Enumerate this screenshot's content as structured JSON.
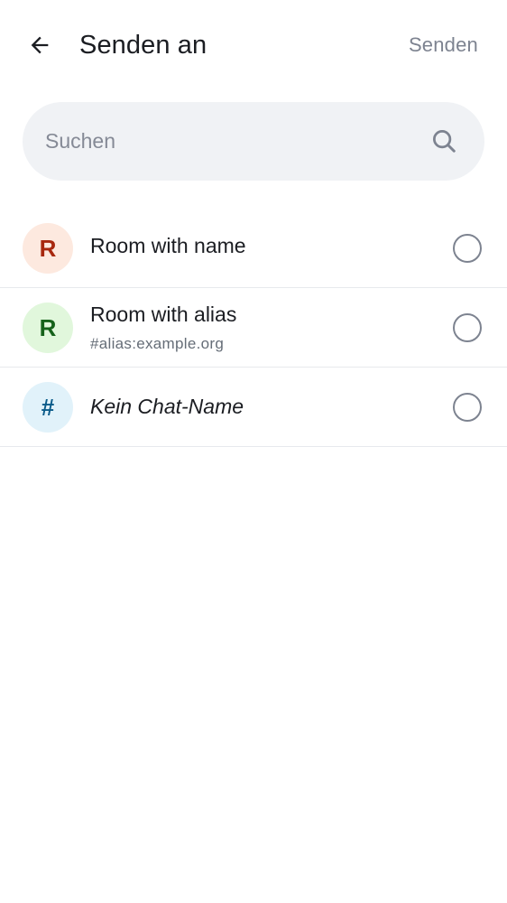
{
  "header": {
    "back_icon": "arrow-left-icon",
    "title": "Senden an",
    "send_label": "Senden"
  },
  "search": {
    "placeholder": "Suchen",
    "value": "",
    "icon": "search-icon"
  },
  "rooms": [
    {
      "initial": "R",
      "name": "Room with name",
      "alias": "",
      "avatar_bg": "#fde9df",
      "avatar_fg": "#a8280f",
      "selected": false
    },
    {
      "initial": "R",
      "name": "Room with alias",
      "alias": "#alias:example.org",
      "avatar_bg": "#e1f7dc",
      "avatar_fg": "#15621a",
      "selected": false
    },
    {
      "initial": "#",
      "name": "Kein Chat-Name",
      "alias": "",
      "avatar_bg": "#e1f2fa",
      "avatar_fg": "#0b5c8a",
      "selected": false
    }
  ],
  "colors": {
    "text_primary": "#1b1d22",
    "text_secondary": "#656d77",
    "disabled": "#7d8390",
    "search_bg": "#f0f2f5",
    "divider": "#e7e9ed"
  }
}
